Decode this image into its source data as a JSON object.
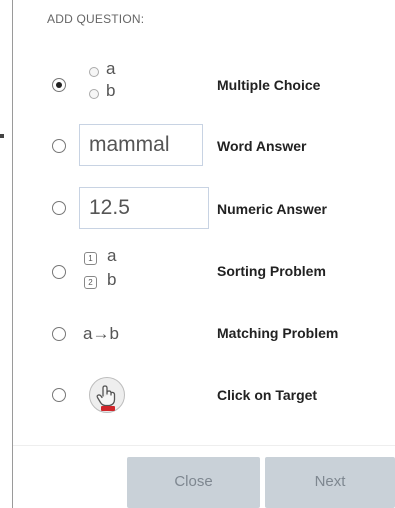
{
  "header": {
    "title": "ADD QUESTION:"
  },
  "options": [
    {
      "id": "multiple-choice",
      "label": "Multiple Choice",
      "checked": true,
      "preview": {
        "a": "a",
        "b": "b"
      }
    },
    {
      "id": "word-answer",
      "label": "Word Answer",
      "checked": false,
      "preview": {
        "value": "mammal"
      }
    },
    {
      "id": "numeric-answer",
      "label": "Numeric Answer",
      "checked": false,
      "preview": {
        "value": "12.5"
      }
    },
    {
      "id": "sorting-problem",
      "label": "Sorting Problem",
      "checked": false,
      "preview": {
        "n1": "1",
        "n2": "2",
        "a": "a",
        "b": "b"
      }
    },
    {
      "id": "matching-problem",
      "label": "Matching Problem",
      "checked": false,
      "preview": {
        "text": "a→b"
      }
    },
    {
      "id": "click-on-target",
      "label": "Click on Target",
      "checked": false,
      "preview": {
        "icon": "hand-pointer-icon"
      }
    }
  ],
  "footer": {
    "close_label": "Close",
    "next_label": "Next"
  },
  "colors": {
    "button_bg": "#c9d1d8",
    "button_text": "#7e8790",
    "target_accent": "#d0262b",
    "input_border": "#c8d3e3"
  }
}
